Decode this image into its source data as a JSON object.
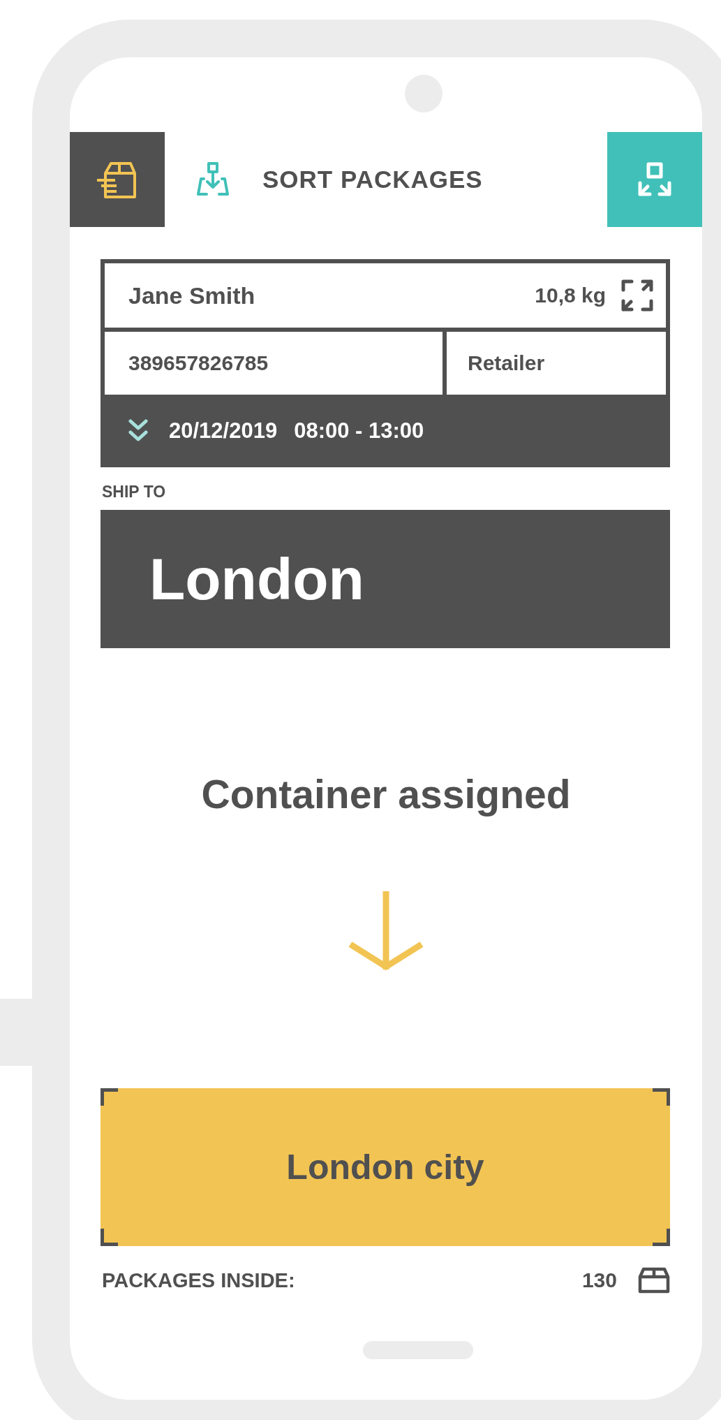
{
  "header": {
    "title": "SORT PACKAGES"
  },
  "package": {
    "recipient": "Jane Smith",
    "weight": "10,8 kg",
    "tracking_number": "389657826785",
    "sender_type": "Retailer",
    "date": "20/12/2019",
    "time_window": "08:00 - 13:00"
  },
  "ship_to": {
    "label": "SHIP TO",
    "city": "London"
  },
  "status": "Container assigned",
  "container": {
    "name": "London city"
  },
  "packages_inside": {
    "label": "PACKAGES INSIDE:",
    "count": "130"
  }
}
